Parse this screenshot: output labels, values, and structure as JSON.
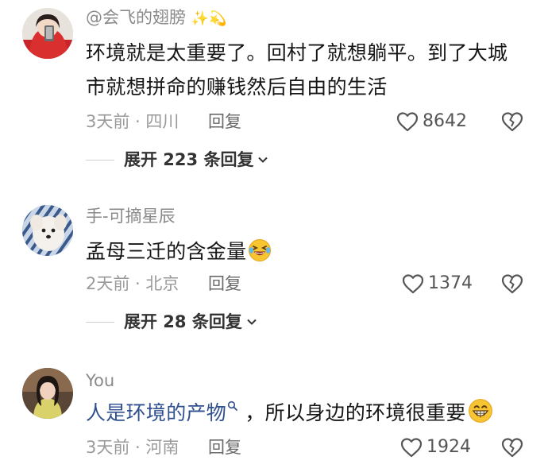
{
  "comments": [
    {
      "username": "@会飞的翅膀",
      "username_emojis": "✨💫",
      "text_line1": "环境就是太重要了。回村了就想躺平。到了大城",
      "text_line2": "市就想拼命的赚钱然后自由的生活",
      "time_location": "3天前 · 四川",
      "reply_label": "回复",
      "likes": "8642",
      "expand_label": "展开 223 条回复"
    },
    {
      "username": "手-可摘星辰",
      "text": "孟母三迁的含金量",
      "text_emoji": "laughing-crying-emoji",
      "time_location": "2天前 · 北京",
      "reply_label": "回复",
      "likes": "1374",
      "expand_label": "展开 28 条回复"
    },
    {
      "username": "You",
      "text_link": "人是环境的产物",
      "text_rest": "，所以身边的环境很重要",
      "text_emoji": "grinning-emoji",
      "time_location": "3天前 · 河南",
      "reply_label": "回复",
      "likes": "1924"
    }
  ],
  "colors": {
    "username": "#8a8a8a",
    "text": "#161616",
    "link": "#2f4f8f",
    "meta": "#9a9a9a",
    "emoji_yellow": "#f7c531"
  }
}
